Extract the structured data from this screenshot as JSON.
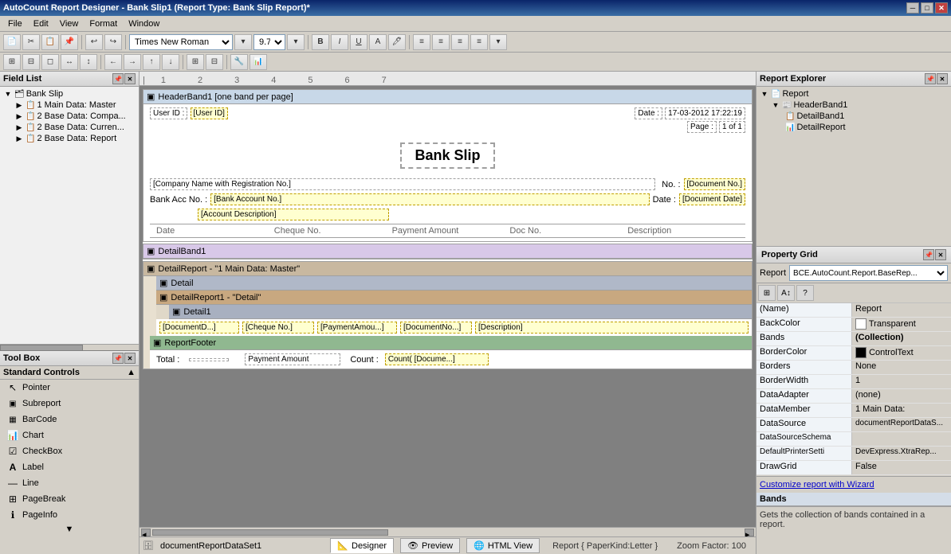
{
  "window": {
    "title": "AutoCount Report Designer - Bank Slip1 (Report Type: Bank Slip Report)*",
    "controls": [
      "minimize",
      "maximize",
      "close"
    ]
  },
  "menu": {
    "items": [
      "File",
      "Edit",
      "View",
      "Format",
      "Window"
    ]
  },
  "toolbar": {
    "font": "Times New Roman",
    "font_size": "9.75",
    "bold": "B",
    "italic": "I",
    "underline": "U"
  },
  "field_list": {
    "title": "Field List",
    "root": "Bank Slip",
    "items": [
      {
        "label": "1 Main Data: Master",
        "indent": 1
      },
      {
        "label": "2 Base Data: Compa...",
        "indent": 1
      },
      {
        "label": "2 Base Data: Curren...",
        "indent": 1
      },
      {
        "label": "2 Base Data: Report",
        "indent": 1
      }
    ]
  },
  "toolbox": {
    "title": "Tool Box",
    "section": "Standard Controls",
    "items": [
      {
        "name": "Pointer",
        "icon": "↖"
      },
      {
        "name": "Subreport",
        "icon": "📋"
      },
      {
        "name": "BarCode",
        "icon": "▦"
      },
      {
        "name": "Chart",
        "icon": "📊"
      },
      {
        "name": "CheckBox",
        "icon": "☑"
      },
      {
        "name": "Label",
        "icon": "A"
      },
      {
        "name": "Line",
        "icon": "—"
      },
      {
        "name": "PageBreak",
        "icon": "⊞"
      },
      {
        "name": "PageInfo",
        "icon": "ℹ"
      }
    ]
  },
  "designer": {
    "bands": {
      "header": {
        "label": "HeaderBand1 [one band per page]",
        "user_id_label": "User ID :",
        "user_id_field": "[User ID]",
        "date_label": "Date :",
        "date_value": "17-03-2012 17:22:19",
        "page_label": "Page :",
        "page_value": "1 of 1",
        "title": "Bank Slip",
        "company_label": "[Company Name with Registration No.]",
        "no_label": "No. :",
        "doc_no_field": "[Document No.]",
        "bank_acc_label": "Bank Acc No. :",
        "bank_acc_field": "[Bank Account No.]",
        "date2_label": "Date :",
        "doc_date_field": "[Document Date]",
        "acc_desc_field": "[Account Description]",
        "col_date": "Date",
        "col_cheque": "Cheque No.",
        "col_payment": "Payment Amount",
        "col_doc": "Doc No.",
        "col_desc": "Description"
      },
      "detail_band1": {
        "label": "DetailBand1"
      },
      "detail_report": {
        "label": "DetailReport - \"1 Main Data: Master\"",
        "detail": "Detail",
        "detail_report1": "DetailReport1 - \"Detail\"",
        "detail1": "Detail1",
        "doc_date_field": "[DocumentD...]",
        "cheque_field": "[Cheque No.]",
        "payment_field": "[PaymentAmou...]",
        "doc_no_field": "[DocumentNo...]",
        "desc_field": "[Description]",
        "footer": "ReportFooter",
        "total_label": "Total :",
        "payment_amount_label": "Payment Amount",
        "count_label": "Count :",
        "count_field": "Count( [Docume...]"
      }
    },
    "tabs": [
      {
        "label": "Designer",
        "active": true
      },
      {
        "label": "Preview"
      },
      {
        "label": "HTML View"
      }
    ],
    "status": "Report { PaperKind:Letter }",
    "zoom": "Zoom Factor: 100"
  },
  "report_explorer": {
    "title": "Report Explorer",
    "items": [
      {
        "label": "Report",
        "indent": 0,
        "icon": "📄"
      },
      {
        "label": "HeaderBand1",
        "indent": 1,
        "icon": "📰"
      },
      {
        "label": "DetailBand1",
        "indent": 2,
        "icon": "📋"
      },
      {
        "label": "DetailReport",
        "indent": 2,
        "icon": "📊"
      }
    ]
  },
  "property_grid": {
    "title": "Property Grid",
    "object_label": "Report",
    "object_class": "BCE.AutoCount.Report.BaseRep...",
    "properties": [
      {
        "name": "(Name)",
        "value": "Report"
      },
      {
        "name": "BackColor",
        "value": "Transparent",
        "swatch": "#ffffff"
      },
      {
        "name": "Bands",
        "value": "(Collection)",
        "bold": true
      },
      {
        "name": "BorderColor",
        "value": "ControlText",
        "swatch": "#000000"
      },
      {
        "name": "Borders",
        "value": "None"
      },
      {
        "name": "BorderWidth",
        "value": "1"
      },
      {
        "name": "DataAdapter",
        "value": "(none)"
      },
      {
        "name": "DataMember",
        "value": "1 Main Data:"
      },
      {
        "name": "DataSource",
        "value": "documentReportDataS..."
      },
      {
        "name": "DataSourceSchema",
        "value": ""
      },
      {
        "name": "DefaultPrinterSetti",
        "value": "DevExpress.XtraRep..."
      },
      {
        "name": "DrawGrid",
        "value": "False"
      }
    ],
    "description_section": "Bands",
    "description_text": "Gets the collection of bands contained in a report."
  },
  "status_bar": {
    "dataset": "documentReportDataSet1",
    "paper": "Report { PaperKind:Letter }",
    "zoom": "Zoom Factor: 100"
  }
}
